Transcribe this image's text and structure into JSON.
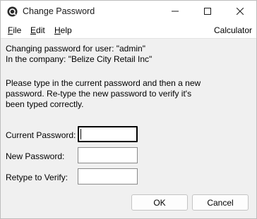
{
  "window": {
    "title": "Change Password",
    "icon": "app-logo-icon"
  },
  "controls": {
    "minimize_icon": "minimize-icon",
    "maximize_icon": "maximize-icon",
    "close_icon": "close-icon"
  },
  "menu": {
    "file": {
      "mnemonic": "F",
      "rest": "ile"
    },
    "edit": {
      "mnemonic": "E",
      "rest": "dit"
    },
    "help": {
      "mnemonic": "H",
      "rest": "elp"
    },
    "calculator": "Calculator"
  },
  "info": {
    "user_line": "Changing password for user: \"admin\"",
    "company_line": "In the company: \"Belize City Retail Inc\"",
    "instructions": [
      "Please type in the current password and then a new",
      "password.  Re-type the new password to verify it's",
      "been typed correctly."
    ]
  },
  "fields": {
    "current": {
      "label": "Current Password:",
      "value": ""
    },
    "new": {
      "label": "New Password:",
      "value": ""
    },
    "verify": {
      "label": "Retype to Verify:",
      "value": ""
    }
  },
  "buttons": {
    "ok": "OK",
    "cancel": "Cancel"
  },
  "colors": {
    "client_bg": "#f0f0f0",
    "window_bg": "#ffffff",
    "focus_border": "#000000"
  }
}
